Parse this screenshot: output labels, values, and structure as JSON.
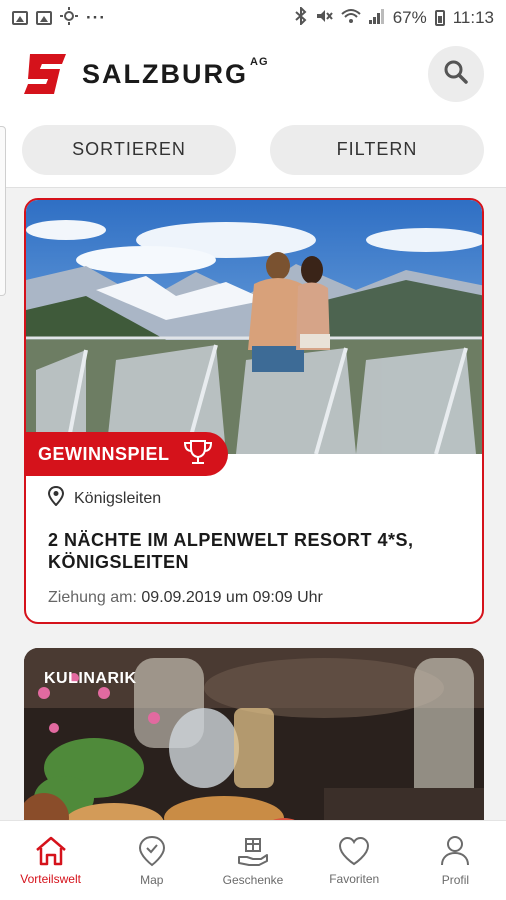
{
  "statusbar": {
    "battery": "67%",
    "time": "11:13",
    "dots": "···"
  },
  "header": {
    "brand": "SALZBURG",
    "brand_suffix": "AG"
  },
  "actions": {
    "sort_label": "SORTIEREN",
    "filter_label": "FILTERN"
  },
  "cards": [
    {
      "badge": "GEWINNSPIEL",
      "location": "Königsleiten",
      "title_line1": "2 NÄCHTE IM ALPENWELT RESORT 4*S,",
      "title_line2": "KÖNIGSLEITEN",
      "draw_label": "Ziehung am:",
      "draw_value": "09.09.2019 um 09:09 Uhr"
    },
    {
      "tag": "KULINARIK"
    }
  ],
  "nav": [
    {
      "label": "Vorteilswelt",
      "icon": "house-icon",
      "active": true
    },
    {
      "label": "Map",
      "icon": "map-pin-icon"
    },
    {
      "label": "Geschenke",
      "icon": "gift-hand-icon"
    },
    {
      "label": "Favoriten",
      "icon": "heart-icon"
    },
    {
      "label": "Profil",
      "icon": "person-icon"
    }
  ],
  "colors": {
    "brand_red": "#d5121b",
    "background": "#f2f2f2"
  }
}
